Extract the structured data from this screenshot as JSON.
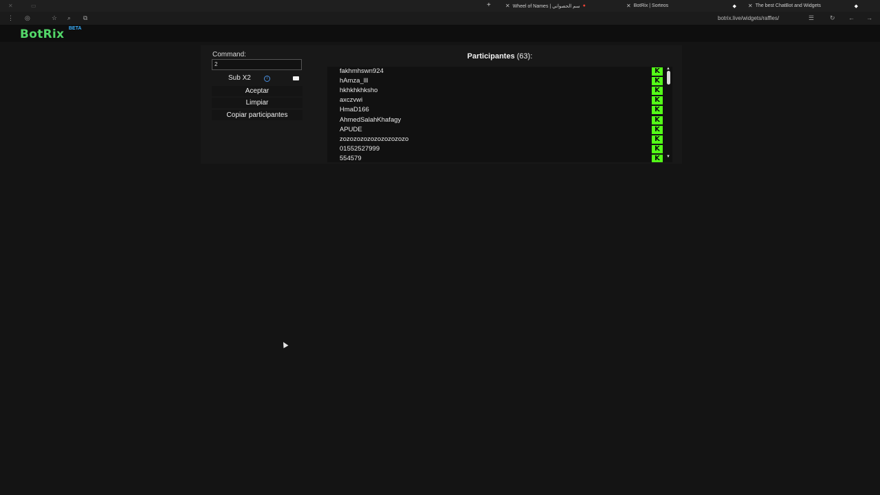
{
  "browser": {
    "tabs": [
      {
        "title": "Wheel of Names | سم الحصواني",
        "active": false
      },
      {
        "title": "BotRix | Sorteos",
        "active": true
      },
      {
        "title": "The best ChatBot and Widgets",
        "active": false
      }
    ],
    "url": "botrix.live/widgets/raffles/"
  },
  "app": {
    "logo": "BotRix",
    "badge": "BETA",
    "accent_color": "#53d769"
  },
  "controls": {
    "command_label": "Command:",
    "command_value": "2",
    "sub_label": "Sub X2",
    "accept_label": "Aceptar",
    "clear_label": "Limpiar",
    "copy_label": "Copiar participantes"
  },
  "participants": {
    "title": "Participantes",
    "count": "(63):",
    "items": [
      "fakhmhswn924",
      "hAmza_lll",
      "hkhkhkhksho",
      "axczvwi",
      "HmaD166",
      "AhmedSalahKhafagy",
      "APUDE",
      "zozozozozozozozozozo",
      "01552527999",
      "554579"
    ],
    "platform_icon": "kick-icon",
    "platform_letter": "K",
    "platform_color": "#53fc18"
  }
}
